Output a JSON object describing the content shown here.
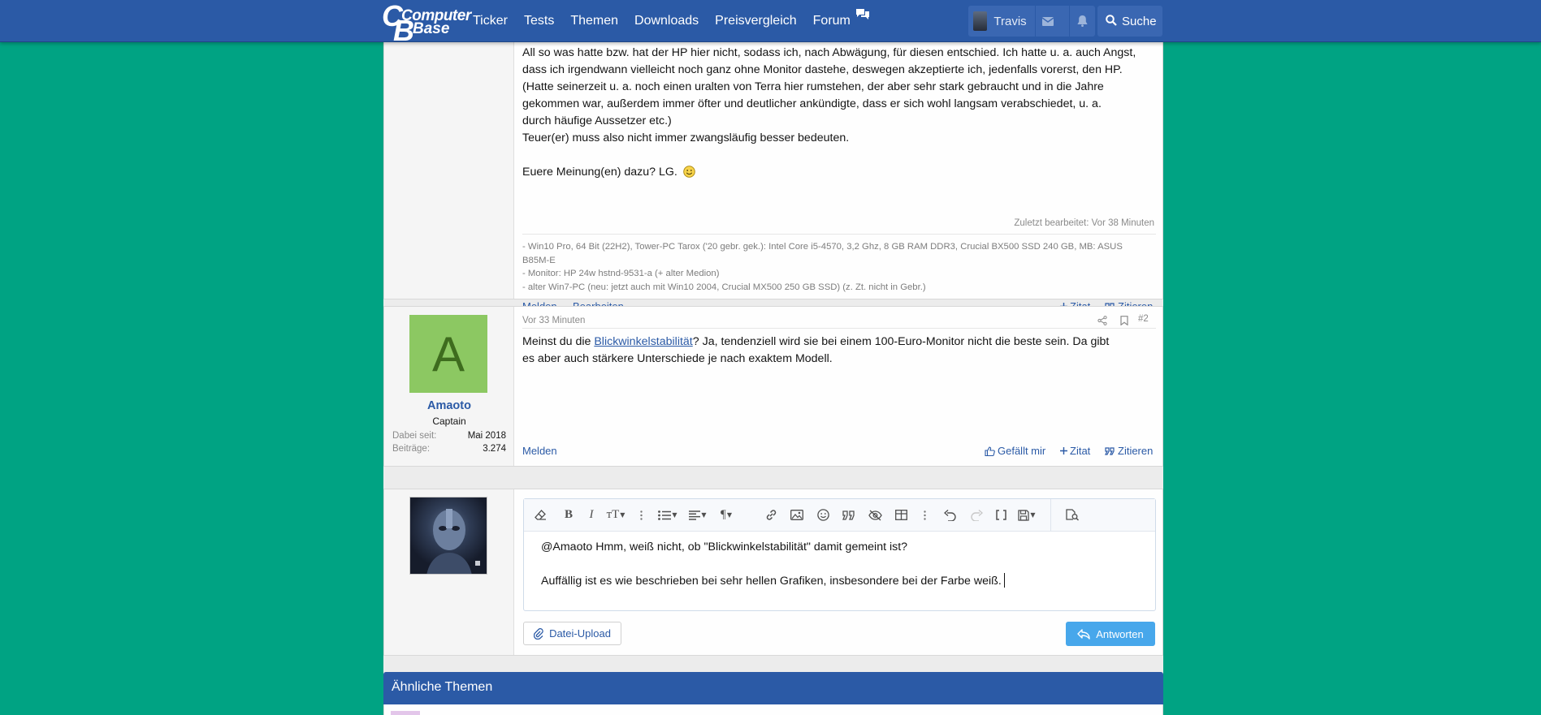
{
  "header": {
    "logo_line1": "Computer",
    "logo_line2": "Base",
    "nav": [
      "Ticker",
      "Tests",
      "Themen",
      "Downloads",
      "Preisvergleich",
      "Forum"
    ],
    "user_name": "Travis",
    "search_label": "Suche",
    "colors": {
      "bar": "#2b5aa6",
      "background": "#00a383",
      "link": "#2b5aa6",
      "reply_button": "#47a7eb"
    }
  },
  "post1": {
    "lines": [
      "All so was hatte bzw. hat der HP hier nicht, sodass ich, nach Abwägung, für diesen entschied. Ich hatte u. a. auch Angst,",
      "dass ich irgendwann vielleicht noch ganz ohne Monitor dastehe, deswegen akzeptierte ich, jedenfalls vorerst, den HP.",
      "(Hatte seinerzeit u. a. noch einen uralten von Terra hier rumstehen, der aber sehr stark gebraucht und in die Jahre",
      "gekommen war, außerdem immer öfter und deutlicher ankündigte, dass er sich wohl langsam verabschiedet, u. a.",
      "durch häufige Aussetzer etc.)",
      "Teuer(er) muss also nicht immer zwangsläufig besser bedeuten."
    ],
    "closing": "Euere Meinung(en) dazu? LG.",
    "edited": "Zuletzt bearbeitet: Vor 38 Minuten",
    "signature": [
      "- Win10 Pro, 64 Bit (22H2), Tower-PC Tarox ('20 gebr. gek.): Intel Core i5-4570, 3,2 Ghz, 8 GB RAM DDR3, Crucial BX500 SSD 240 GB, MB: ASUS",
      "B85M-E",
      "- Monitor: HP 24w hstnd-9531-a (+ alter Medion)",
      "- alter Win7-PC (neu: jetzt auch mit Win10 2004, Crucial MX500 250 GB SSD) (z. Zt. nicht in Gebr.)"
    ],
    "actions": {
      "report": "Melden",
      "edit": "Bearbeiten",
      "quote_add": "Zitat",
      "quote": "Zitieren"
    }
  },
  "post2": {
    "avatar_letter": "A",
    "username": "Amaoto",
    "user_title": "Captain",
    "stats": [
      {
        "key": "Dabei seit:",
        "value": "Mai 2018"
      },
      {
        "key": "Beiträge:",
        "value": "3.274"
      }
    ],
    "time": "Vor 33 Minuten",
    "number": "#2",
    "text_before": "Meinst du die ",
    "link_text": "Blickwinkelstabilität",
    "text_after_line1": "? Ja, tendenziell wird sie bei einem 100-Euro-Monitor nicht die beste sein. Da gibt",
    "text_line2": "es aber auch stärkere Unterschiede je nach exaktem Modell.",
    "actions": {
      "report": "Melden",
      "like": "Gefällt mir",
      "quote_add": "Zitat",
      "quote": "Zitieren"
    }
  },
  "editor": {
    "line1": "@Amaoto Hmm, weiß nicht, ob \"Blickwinkelstabilität\" damit gemeint ist?",
    "line2": "Auffällig ist es wie beschrieben bei sehr hellen Grafiken, insbesondere bei der Farbe weiß.",
    "upload_label": "Datei-Upload",
    "reply_label": "Antworten"
  },
  "similar": {
    "title": "Ähnliche Themen"
  }
}
